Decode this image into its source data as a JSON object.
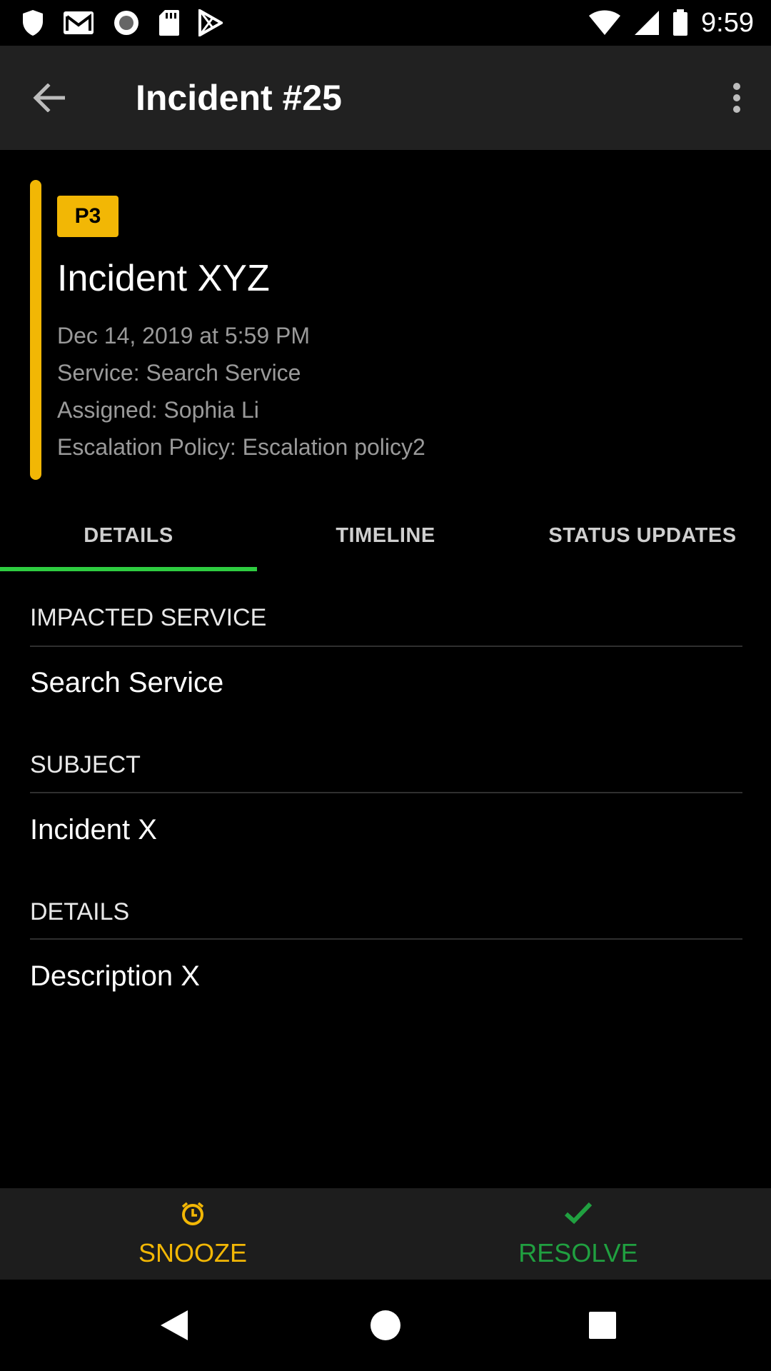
{
  "status_bar": {
    "time": "9:59",
    "left_icons": [
      "shield-icon",
      "gmail-icon",
      "circle-record-icon",
      "sd-card-icon",
      "play-store-icon"
    ],
    "right_icons": [
      "wifi-icon",
      "signal-icon",
      "battery-icon"
    ]
  },
  "app_bar": {
    "title": "Incident #25",
    "back_icon": "arrow-back-icon",
    "menu_icon": "more-vert-icon"
  },
  "incident": {
    "priority": "P3",
    "priority_color": "#f2b705",
    "name": "Incident XYZ",
    "date": "Dec 14, 2019 at 5:59 PM",
    "service": "Service: Search Service",
    "assigned": "Assigned: Sophia Li",
    "escalation_policy": "Escalation Policy: Escalation policy2"
  },
  "tabs": [
    {
      "label": "DETAILS",
      "selected": true
    },
    {
      "label": "TIMELINE",
      "selected": false
    },
    {
      "label": "STATUS UPDATES",
      "selected": false
    }
  ],
  "details": {
    "sections": [
      {
        "label": "IMPACTED SERVICE",
        "value": "Search Service"
      },
      {
        "label": "SUBJECT",
        "value": "Incident X"
      },
      {
        "label": "DETAILS",
        "value": "Description X"
      }
    ]
  },
  "actions": {
    "snooze": {
      "label": "SNOOZE",
      "icon": "alarm-clock-icon",
      "color": "#f2b705"
    },
    "resolve": {
      "label": "RESOLVE",
      "icon": "checkmark-icon",
      "color": "#20a040"
    }
  },
  "nav_bar": {
    "icons": [
      "nav-back-icon",
      "nav-home-icon",
      "nav-recents-icon"
    ]
  },
  "colors": {
    "tab_indicator": "#2ecc40",
    "app_bar_bg": "#212121",
    "action_bar_bg": "#1d1d1d"
  }
}
